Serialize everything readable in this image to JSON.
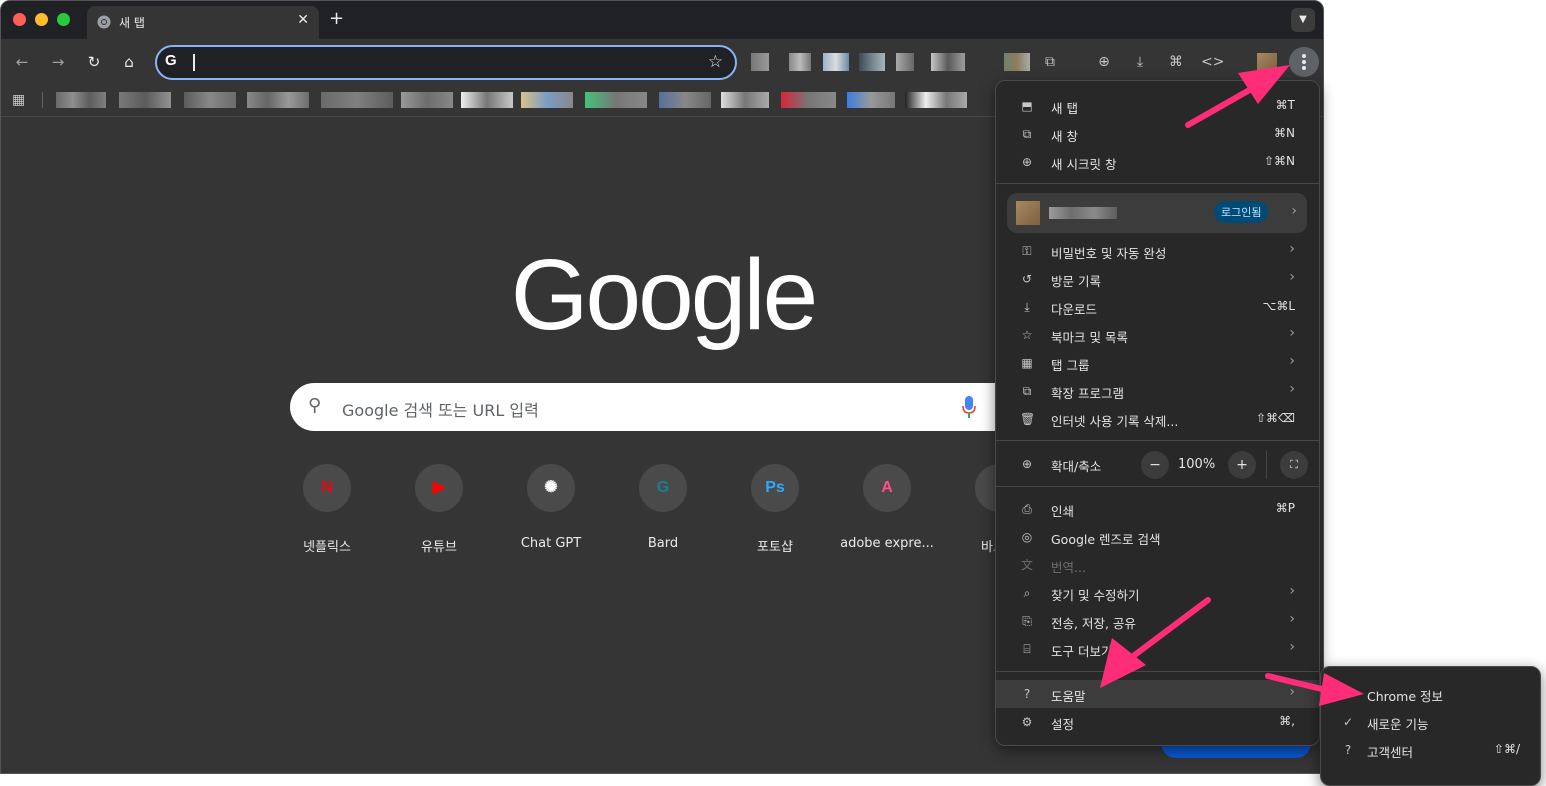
{
  "tab": {
    "title": "새 탭",
    "close": "✕",
    "new_tab": "+"
  },
  "omnibox": {
    "value": "",
    "placeholder": ""
  },
  "ntp": {
    "logo": "Google",
    "search_placeholder": "Google 검색 또는 URL 입력",
    "shortcuts": [
      {
        "label": "넷플릭스",
        "glyph": "N",
        "color": "#e50914"
      },
      {
        "label": "유튜브",
        "glyph": "▶",
        "color": "#ff0000"
      },
      {
        "label": "Chat GPT",
        "glyph": "✺",
        "color": "#ffffff"
      },
      {
        "label": "Bard",
        "glyph": "G",
        "color": "#1a7f8c"
      },
      {
        "label": "포토샵",
        "glyph": "Ps",
        "color": "#31a8ff"
      },
      {
        "label": "adobe expre...",
        "glyph": "A",
        "color": "#ff4f8b"
      },
      {
        "label": "바로가",
        "glyph": "+",
        "color": "#1a73e8"
      }
    ]
  },
  "menu": {
    "new_tab": {
      "label": "새 탭",
      "shortcut": "⌘T"
    },
    "new_window": {
      "label": "새 창",
      "shortcut": "⌘N"
    },
    "incognito": {
      "label": "새 시크릿 창",
      "shortcut": "⇧⌘N"
    },
    "profile": {
      "badge": "로그인됨"
    },
    "passwords": {
      "label": "비밀번호 및 자동 완성"
    },
    "history": {
      "label": "방문 기록"
    },
    "downloads": {
      "label": "다운로드",
      "shortcut": "⌥⌘L"
    },
    "bookmarks": {
      "label": "북마크 및 목록"
    },
    "tab_groups": {
      "label": "탭 그룹"
    },
    "extensions": {
      "label": "확장 프로그램"
    },
    "clear_data": {
      "label": "인터넷 사용 기록 삭제...",
      "shortcut": "⇧⌘⌫"
    },
    "zoom": {
      "label": "확대/축소",
      "minus": "−",
      "value": "100%",
      "plus": "+"
    },
    "print": {
      "label": "인쇄",
      "shortcut": "⌘P"
    },
    "lens": {
      "label": "Google 렌즈로 검색"
    },
    "translate": {
      "label": "번역..."
    },
    "find_edit": {
      "label": "찾기 및 수정하기"
    },
    "cast_save_share": {
      "label": "전송, 저장, 공유"
    },
    "more_tools": {
      "label": "도구 더보기"
    },
    "help": {
      "label": "도움말"
    },
    "settings": {
      "label": "설정",
      "shortcut": "⌘,"
    }
  },
  "help_submenu": {
    "about": {
      "label": "Chrome 정보"
    },
    "whats_new": {
      "label": "새로운 기능"
    },
    "help_center": {
      "label": "고객센터",
      "shortcut": "⇧⌘/"
    }
  },
  "colors": {
    "accent": "#8ab4f8",
    "annotation_arrow": "#ff2d78",
    "menu_bg": "#282828",
    "page_bg": "#353535"
  }
}
